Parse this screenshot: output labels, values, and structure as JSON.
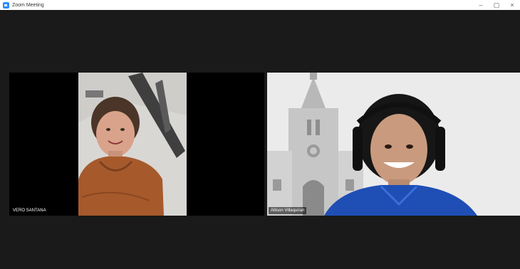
{
  "window": {
    "title": "Zoom Meeting",
    "controls": {
      "minimize": "–",
      "maximize": "▢",
      "close": "×"
    }
  },
  "participants": [
    {
      "name": "VERO SANTANA"
    },
    {
      "name": "Allison Villaquiran"
    }
  ],
  "colors": {
    "accent": "#2d8cff",
    "meeting_bg": "#1a1a1a",
    "shirt_left": "#a65a2c",
    "jacket_right": "#1f4fb5"
  },
  "icons": {
    "app": "zoom-logo-icon"
  }
}
